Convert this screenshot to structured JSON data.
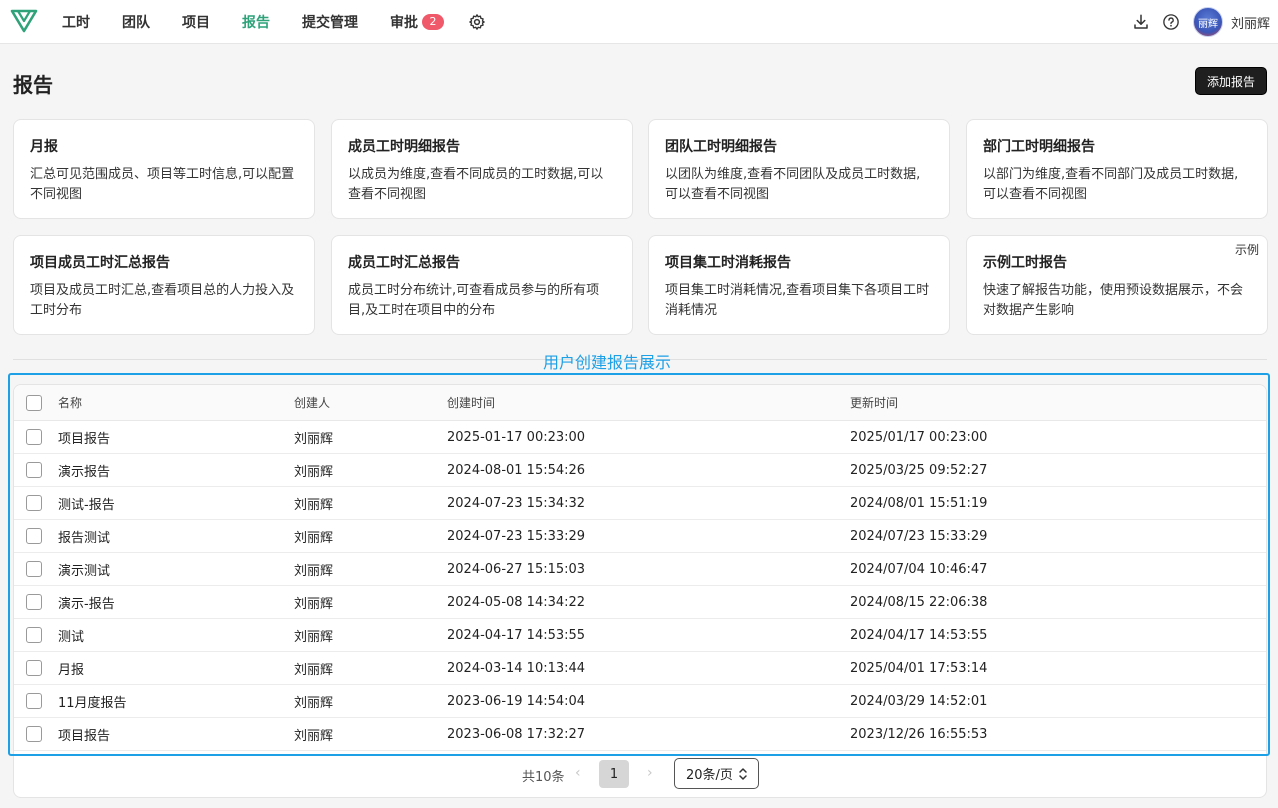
{
  "nav": {
    "items": [
      {
        "label": "工时",
        "active": false
      },
      {
        "label": "团队",
        "active": false
      },
      {
        "label": "项目",
        "active": false
      },
      {
        "label": "报告",
        "active": true
      },
      {
        "label": "提交管理",
        "active": false
      },
      {
        "label": "审批",
        "active": false,
        "badge": "2"
      }
    ],
    "username": "刘丽辉",
    "avatar_text": "丽辉",
    "accent_color": "#2fa27a",
    "badge_color": "#f0596a"
  },
  "page": {
    "title": "报告",
    "add_button": "添加报告"
  },
  "cards": [
    {
      "title": "月报",
      "desc": "汇总可见范围成员、项目等工时信息,可以配置不同视图"
    },
    {
      "title": "成员工时明细报告",
      "desc": "以成员为维度,查看不同成员的工时数据,可以查看不同视图"
    },
    {
      "title": "团队工时明细报告",
      "desc": "以团队为维度,查看不同团队及成员工时数据,可以查看不同视图"
    },
    {
      "title": "部门工时明细报告",
      "desc": "以部门为维度,查看不同部门及成员工时数据,可以查看不同视图"
    },
    {
      "title": "项目成员工时汇总报告",
      "desc": "项目及成员工时汇总,查看项目总的人力投入及工时分布"
    },
    {
      "title": "成员工时汇总报告",
      "desc": "成员工时分布统计,可查看成员参与的所有项目,及工时在项目中的分布"
    },
    {
      "title": "项目集工时消耗报告",
      "desc": "项目集工时消耗情况,查看项目集下各项目工时消耗情况"
    },
    {
      "title": "示例工时报告",
      "desc": "快速了解报告功能，使用预设数据展示，不会对数据产生影响",
      "tag": "示例"
    }
  ],
  "annotation_label": "用户创建报告展示",
  "annotation_color": "#1ea0e6",
  "table": {
    "headers": {
      "name": "名称",
      "creator": "创建人",
      "created": "创建时间",
      "updated": "更新时间"
    },
    "rows": [
      {
        "name": "项目报告",
        "creator": "刘丽辉",
        "created": "2025-01-17 00:23:00",
        "updated": "2025/01/17 00:23:00"
      },
      {
        "name": "演示报告",
        "creator": "刘丽辉",
        "created": "2024-08-01 15:54:26",
        "updated": "2025/03/25 09:52:27"
      },
      {
        "name": "测试-报告",
        "creator": "刘丽辉",
        "created": "2024-07-23 15:34:32",
        "updated": "2024/08/01 15:51:19"
      },
      {
        "name": "报告测试",
        "creator": "刘丽辉",
        "created": "2024-07-23 15:33:29",
        "updated": "2024/07/23 15:33:29"
      },
      {
        "name": "演示测试",
        "creator": "刘丽辉",
        "created": "2024-06-27 15:15:03",
        "updated": "2024/07/04 10:46:47"
      },
      {
        "name": "演示-报告",
        "creator": "刘丽辉",
        "created": "2024-05-08 14:34:22",
        "updated": "2024/08/15 22:06:38"
      },
      {
        "name": "测试",
        "creator": "刘丽辉",
        "created": "2024-04-17 14:53:55",
        "updated": "2024/04/17 14:53:55"
      },
      {
        "name": "月报",
        "creator": "刘丽辉",
        "created": "2024-03-14 10:13:44",
        "updated": "2025/04/01 17:53:14"
      },
      {
        "name": "11月度报告",
        "creator": "刘丽辉",
        "created": "2023-06-19 14:54:04",
        "updated": "2024/03/29 14:52:01"
      },
      {
        "name": "项目报告",
        "creator": "刘丽辉",
        "created": "2023-06-08 17:32:27",
        "updated": "2023/12/26 16:55:53"
      }
    ]
  },
  "pagination": {
    "total": "共10条",
    "prev": "‹",
    "current_page": "1",
    "next": "›",
    "page_size": "20条/页"
  }
}
